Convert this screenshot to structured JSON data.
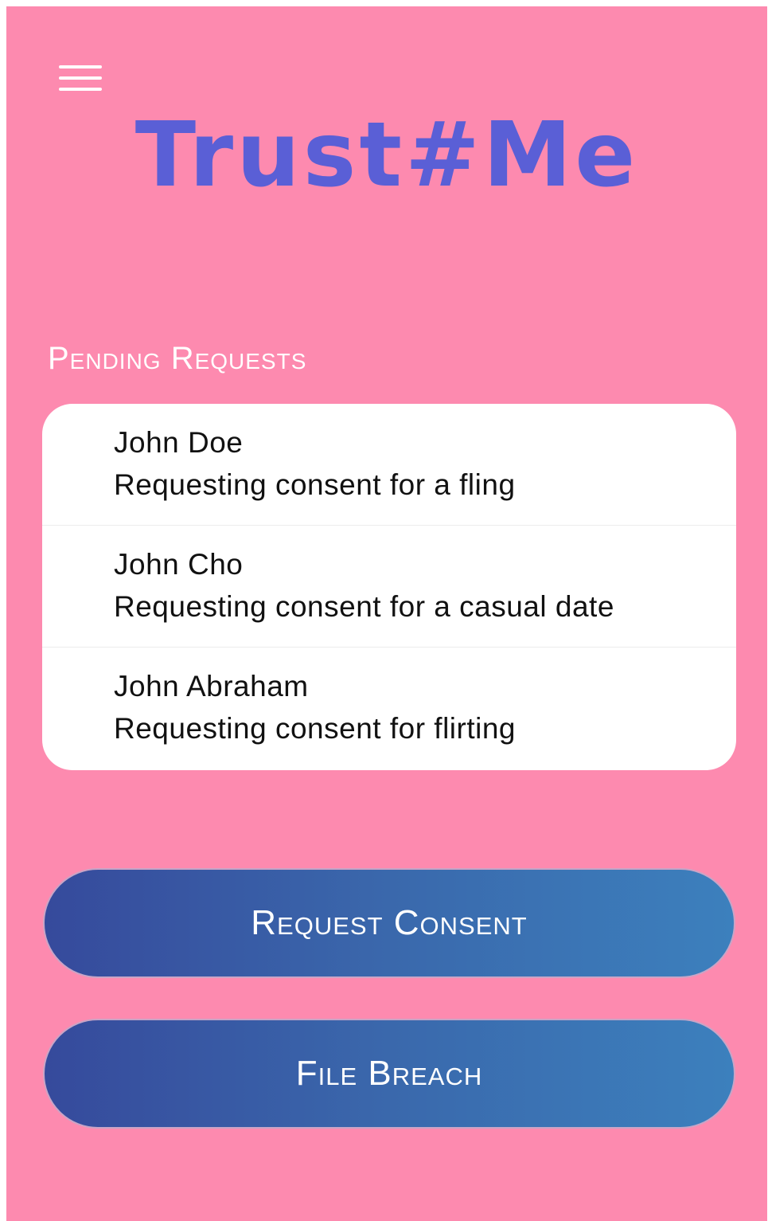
{
  "app": {
    "title": "Trust#Me"
  },
  "header": {
    "menu_icon": "hamburger-menu-icon"
  },
  "pending": {
    "title": "Pending Requests",
    "items": [
      {
        "name": "John Doe",
        "description": "Requesting consent for a fling"
      },
      {
        "name": "John Cho",
        "description": "Requesting consent for a casual date"
      },
      {
        "name": "John Abraham",
        "description": "Requesting consent for flirting"
      }
    ]
  },
  "actions": {
    "request_consent_label": "Request Consent",
    "file_breach_label": "File Breach"
  },
  "colors": {
    "background": "#fd8aaf",
    "title": "#5a5fd6",
    "button_gradient_start": "#364a9c",
    "button_gradient_end": "#3c80bd",
    "card": "#ffffff"
  }
}
